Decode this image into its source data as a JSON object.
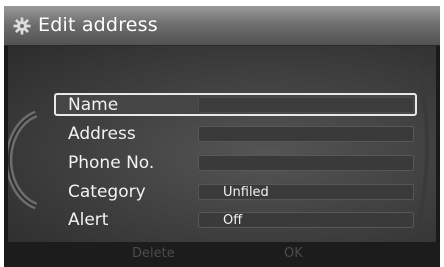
{
  "window": {
    "title": "Edit address",
    "title_icon": "gear-icon"
  },
  "fields": [
    {
      "label": "Name",
      "value": "",
      "selected": true
    },
    {
      "label": "Address",
      "value": ""
    },
    {
      "label": "Phone No.",
      "value": ""
    },
    {
      "label": "Category",
      "value": "Unfiled"
    },
    {
      "label": "Alert",
      "value": "Off"
    }
  ],
  "bottom_bar": {
    "delete_label": "Delete",
    "ok_label": "OK"
  },
  "colors": {
    "selection_outline": "#e8e8e8",
    "disabled_text": "#4c4c4c"
  }
}
